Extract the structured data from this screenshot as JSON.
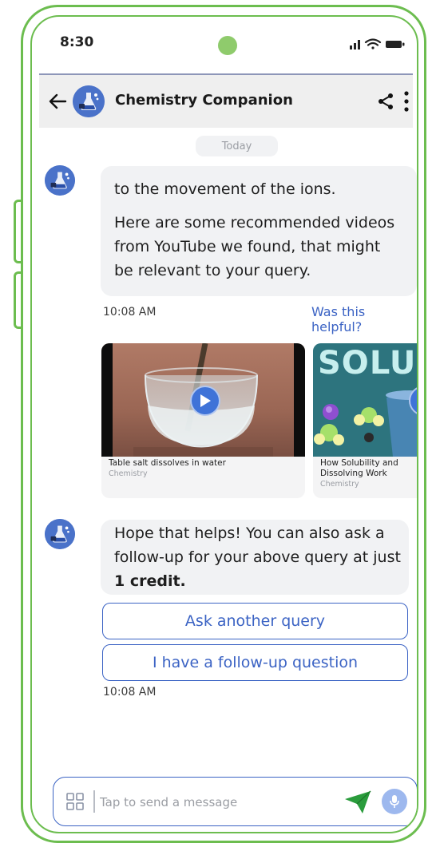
{
  "status_bar": {
    "time": "8:30"
  },
  "header": {
    "title": "Chemistry Companion"
  },
  "chat": {
    "date_label": "Today",
    "messages": [
      {
        "paragraphs": [
          "to the movement of the ions.",
          "Here are some recommended videos from YouTube we found, that might be relevant to your query."
        ],
        "time": "10:08 AM",
        "feedback_link": "Was this helpful?"
      },
      {
        "text_prefix": "Hope that helps! You can also ask a follow-up for your above query at just ",
        "text_bold": "1 credit.",
        "time": "10:08 AM"
      }
    ],
    "videos": [
      {
        "title": "Table salt dissolves in water",
        "category": "Chemistry"
      },
      {
        "title": "How Solubility and Dissolving Work",
        "category": "Chemistry",
        "thumb_text": "SOLUB"
      }
    ],
    "actions": [
      "Ask another query",
      "I have a follow-up question"
    ]
  },
  "composer": {
    "placeholder": "Tap to send a message"
  },
  "colors": {
    "frame": "#6cbd4f",
    "accent": "#3b63c4",
    "bubble": "#f1f2f4",
    "send": "#2a9c3c",
    "mic": "#9db8ee"
  },
  "icons": [
    "back-arrow-icon",
    "flask-icon",
    "share-icon",
    "more-vertical-icon",
    "play-icon",
    "grid-icon",
    "send-icon",
    "mic-icon"
  ]
}
